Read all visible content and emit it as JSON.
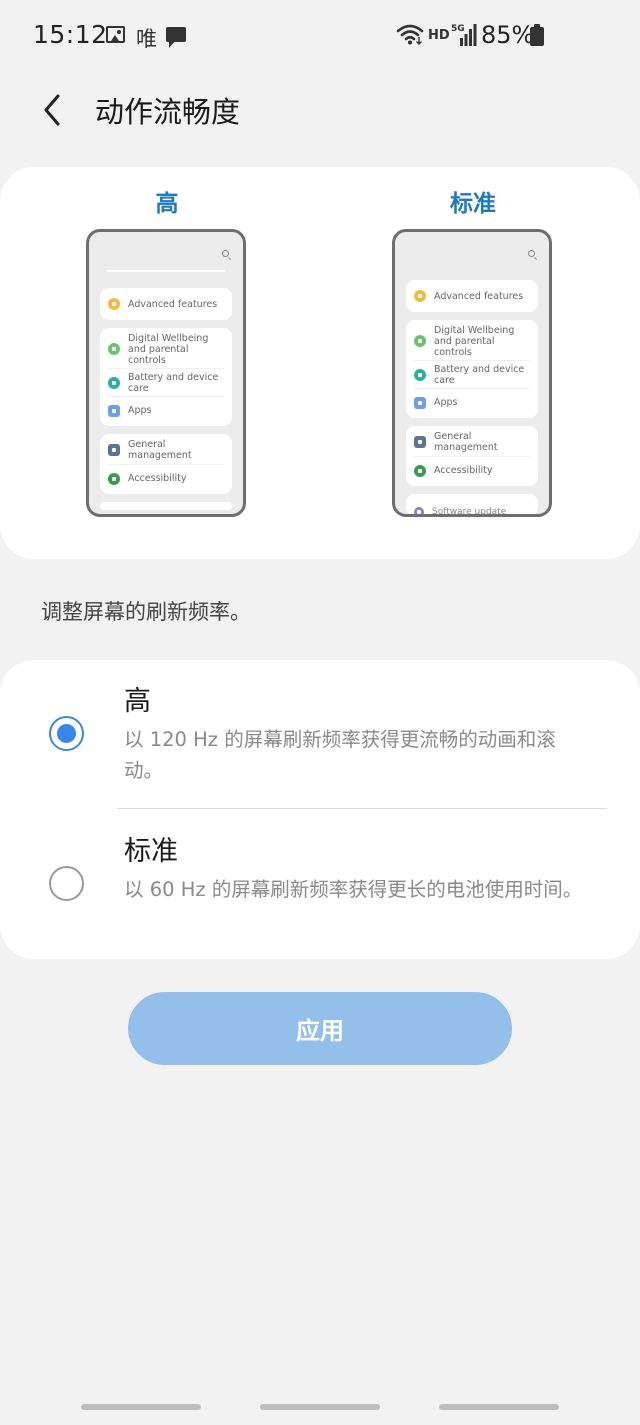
{
  "status_bar": {
    "time": "15:12",
    "notification_char": "唯",
    "network_hd": "HD",
    "network_type": "5G",
    "battery": "85%",
    "icons": [
      "gallery-icon",
      "message-icon",
      "wifi-icon",
      "signal-icon",
      "battery-icon"
    ]
  },
  "header": {
    "title": "动作流畅度",
    "back_icon": "chevron-left-icon"
  },
  "preview": {
    "high_label": "高",
    "standard_label": "标准",
    "phone_items": {
      "advanced": "Advanced features",
      "wellbeing": "Digital Wellbeing and parental controls",
      "battery": "Battery and device care",
      "apps": "Apps",
      "general": "General management",
      "accessibility": "Accessibility",
      "software_partial": "Software update"
    },
    "icon_colors": {
      "advanced": "#f4b942",
      "wellbeing": "#6cc26c",
      "battery": "#27b1a0",
      "apps": "#6e9ee8",
      "general": "#5c7392",
      "accessibility": "#3a9a4e",
      "software": "#7b85d9"
    }
  },
  "description": "调整屏幕的刷新频率。",
  "options": [
    {
      "title": "高",
      "desc": "以 120 Hz 的屏幕刷新频率获得更流畅的动画和滚动。",
      "selected": true
    },
    {
      "title": "标准",
      "desc": "以 60 Hz 的屏幕刷新频率获得更长的电池使用时间。",
      "selected": false
    }
  ],
  "apply_label": "应用",
  "colors": {
    "accent": "#3a87e8",
    "label_blue": "#1e78c8",
    "apply_button": "#94bfeb",
    "background": "#f2f2f2"
  }
}
